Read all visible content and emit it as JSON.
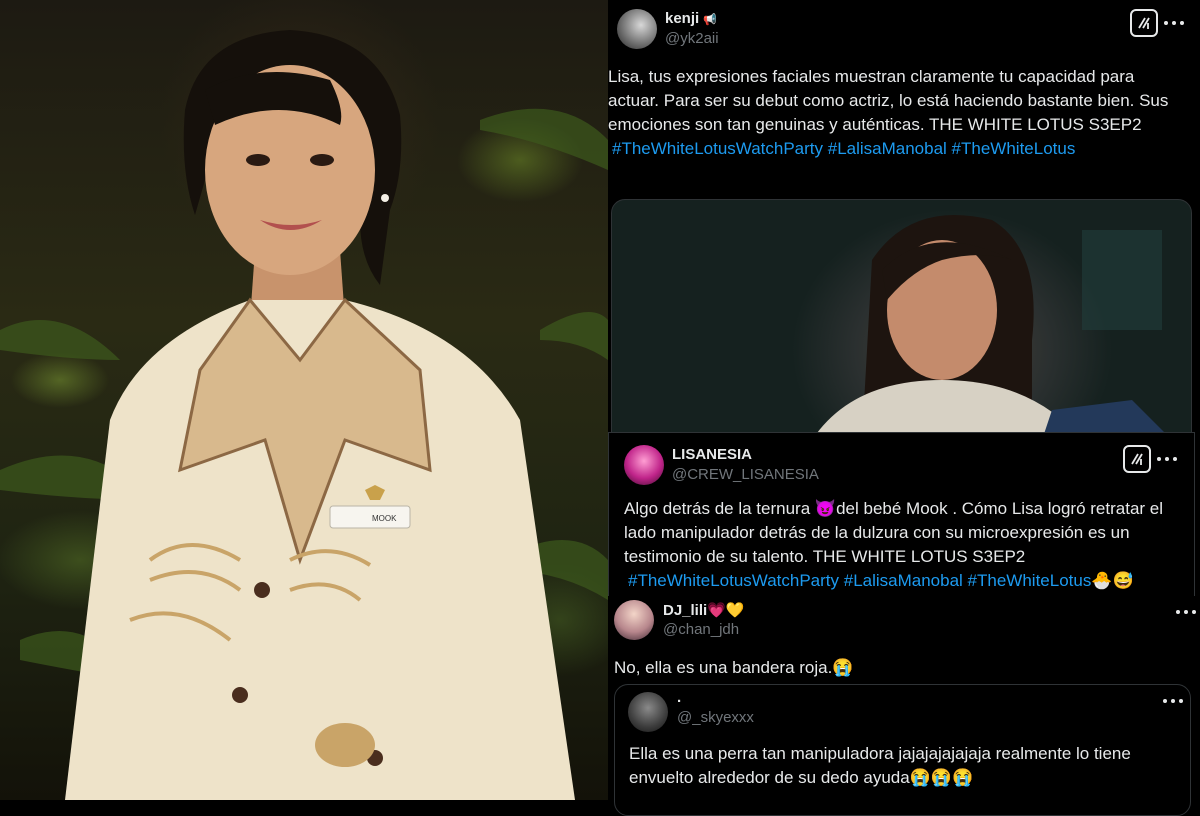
{
  "tweet1": {
    "name": "kenji",
    "handle": "@yk2aii",
    "text": "Lisa, tus expresiones faciales muestran claramente tu capacidad para actuar. Para ser su debut como actriz, lo está haciendo bastante bien. Sus emociones son tan genuinas y auténticas. THE WHITE LOTUS S3EP2",
    "hashtags": "#TheWhiteLotusWatchParty #LalisaManobal #TheWhiteLotus"
  },
  "tweet2": {
    "name": "LISANESIA",
    "handle": "@CREW_LISANESIA",
    "text_a": "Algo detrás de la ternura ",
    "emoji_a": "😈",
    "text_b": "del bebé Mook . Cómo Lisa logró retratar el lado manipulador detrás de la dulzura con su microexpresión es un testimonio de su talento. THE WHITE LOTUS S3EP2",
    "hashtags": "#TheWhiteLotusWatchParty #LalisaManobal #TheWhiteLotus",
    "emoji_end": "🐣😅"
  },
  "tweet3": {
    "name": "DJ_lili",
    "name_emoji": "💗💛",
    "handle": "@chan_jdh",
    "text": "No, ella es una bandera roja.😭",
    "quote": {
      "name": ".",
      "handle": "@_skyexxx",
      "text": "Ella es una perra tan manipuladora jajajajajajaja realmente lo tiene envuelto alrededor de su dedo ayuda😭😭😭"
    }
  },
  "photo": {
    "badge_text": "MOOK"
  },
  "colors": {
    "link": "#1d9bf0",
    "text": "#e7e9ea",
    "muted": "#71767b",
    "border": "#2f3336"
  }
}
